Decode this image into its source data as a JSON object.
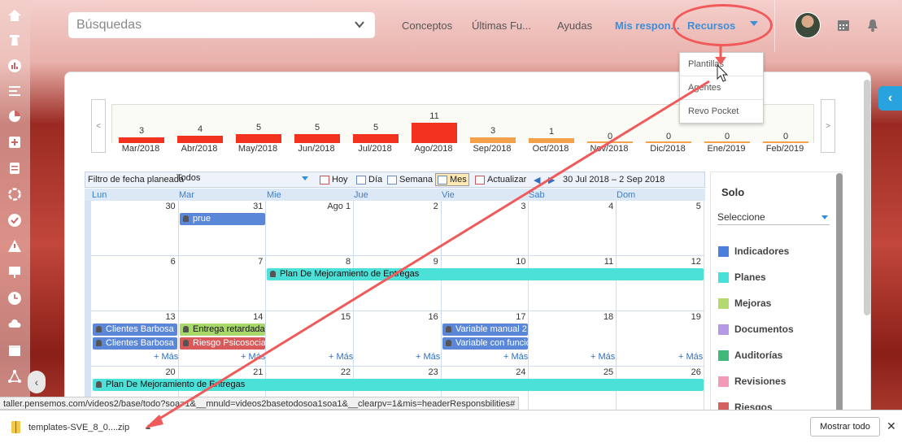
{
  "sidebar": {
    "icons": [
      "home-icon",
      "tower-icon",
      "bar-chart-icon",
      "align-icon",
      "pie-chart-icon",
      "plus-square-icon",
      "list-icon",
      "cycle-icon",
      "check-circle-icon",
      "warning-icon",
      "presentation-icon",
      "clock-icon",
      "cloud-icon",
      "calendar-icon",
      "network-icon"
    ]
  },
  "header": {
    "search_placeholder": "Búsquedas",
    "nav": [
      "Conceptos",
      "Últimas Fu...",
      "Ayudas",
      "Mis respon..."
    ],
    "recursos": "Recursos",
    "dropdown": [
      "Plantillas",
      "Agentes",
      "Revo Pocket"
    ]
  },
  "chart_data": {
    "type": "bar",
    "title": "",
    "categories": [
      "Mar/2018",
      "Abr/2018",
      "May/2018",
      "Jun/2018",
      "Jul/2018",
      "Ago/2018",
      "Sep/2018",
      "Oct/2018",
      "Nov/2018",
      "Dic/2018",
      "Ene/2019",
      "Feb/2019"
    ],
    "values": [
      3,
      4,
      5,
      5,
      5,
      11,
      3,
      1,
      0,
      0,
      0,
      0
    ],
    "colors": [
      "#f0321e",
      "#f0321e",
      "#f0321e",
      "#f0321e",
      "#f0321e",
      "#f0321e",
      "#f5a04a",
      "#f5a04a",
      "#f5a04a",
      "#f5a04a",
      "#f5a04a",
      "#f5a04a"
    ],
    "ylim": [
      0,
      11
    ]
  },
  "calendar": {
    "filter_label": "Filtro de fecha planeada",
    "filter_value": "Todos",
    "buttons": [
      "Hoy",
      "Día",
      "Semana",
      "Mes",
      "Actualizar"
    ],
    "range": "30 Jul 2018 – 2 Sep 2018",
    "days": [
      "Lun",
      "Mar",
      "Mie",
      "Jue",
      "Vie",
      "Sab",
      "Dom"
    ],
    "weeks": [
      [
        "30",
        "31",
        "Ago 1",
        "2",
        "3",
        "4",
        "5"
      ],
      [
        "6",
        "7",
        "8",
        "9",
        "10",
        "11",
        "12"
      ],
      [
        "13",
        "14",
        "15",
        "16",
        "17",
        "18",
        "19"
      ],
      [
        "20",
        "21",
        "22",
        "23",
        "24",
        "25",
        "26"
      ]
    ],
    "events": {
      "prue": "prue",
      "plan1": "Plan De Mejoramiento de Entregas",
      "cb1": "Clientes Barbosa",
      "cb2": "Clientes Barbosa",
      "entrega": "Entrega retardada",
      "riesgo": "Riesgo Psicosocial",
      "var1": "Variable manual 2",
      "var2": "Variable con funcio",
      "plan2": "Plan De Mejoramiento de Entregas"
    },
    "more": "+ Más"
  },
  "filter_panel": {
    "title": "Solo",
    "select": "Seleccione",
    "legend": [
      {
        "label": "Indicadores",
        "color": "#4a7fdc"
      },
      {
        "label": "Planes",
        "color": "#45e0d8"
      },
      {
        "label": "Mejoras",
        "color": "#b4d96e"
      },
      {
        "label": "Documentos",
        "color": "#b49ae6"
      },
      {
        "label": "Auditorías",
        "color": "#3fb87a"
      },
      {
        "label": "Revisiones",
        "color": "#f39ab8"
      },
      {
        "label": "Riesgos",
        "color": "#d46060"
      }
    ]
  },
  "status_url": "taller.pensemos.com/videos2/base/todo?soa=1&__mnuld=videos2basetodosoa1soa1&__clearpv=1&mis=headerResponsbilities#",
  "download": {
    "file": "templates-SVE_8_0....zip",
    "show_all": "Mostrar todo"
  }
}
